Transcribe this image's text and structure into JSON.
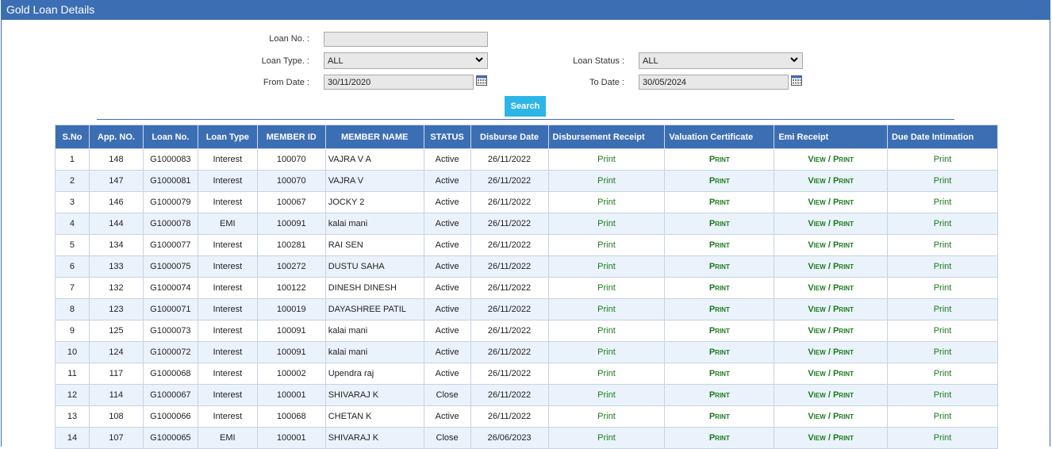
{
  "header": {
    "title": "Gold Loan Details"
  },
  "filters": {
    "loan_no_label": "Loan No. :",
    "loan_no_value": "",
    "loan_type_label": "Loan Type. :",
    "loan_type_value": "ALL",
    "loan_status_label": "Loan Status :",
    "loan_status_value": "ALL",
    "from_date_label": "From Date :",
    "from_date_value": "30/11/2020",
    "to_date_label": "To Date :",
    "to_date_value": "30/05/2024",
    "search_label": "Search"
  },
  "table": {
    "headers": [
      "S.No",
      "App. NO.",
      "Loan No.",
      "Loan Type",
      "MEMBER ID",
      "MEMBER NAME",
      "STATUS",
      "Disburse Date",
      "Disbursement Receipt",
      "Valuation Certificate",
      "Emi Receipt",
      "Due Date Intimation"
    ],
    "rows": [
      {
        "sno": "1",
        "app": "148",
        "loan": "G1000083",
        "type": "Interest",
        "member_id": "100070",
        "name": "VAJRA V A",
        "status": "Active",
        "date": "26/11/2022",
        "disb": "Print",
        "val": "Print",
        "emi": "View / Print",
        "due": "Print"
      },
      {
        "sno": "2",
        "app": "147",
        "loan": "G1000081",
        "type": "Interest",
        "member_id": "100070",
        "name": "VAJRA V",
        "status": "Active",
        "date": "26/11/2022",
        "disb": "Print",
        "val": "Print",
        "emi": "View / Print",
        "due": "Print"
      },
      {
        "sno": "3",
        "app": "146",
        "loan": "G1000079",
        "type": "Interest",
        "member_id": "100067",
        "name": "JOCKY 2",
        "status": "Active",
        "date": "26/11/2022",
        "disb": "Print",
        "val": "Print",
        "emi": "View / Print",
        "due": "Print"
      },
      {
        "sno": "4",
        "app": "144",
        "loan": "G1000078",
        "type": "EMI",
        "member_id": "100091",
        "name": "kalai mani",
        "status": "Active",
        "date": "26/11/2022",
        "disb": "Print",
        "val": "Print",
        "emi": "View / Print",
        "due": "Print"
      },
      {
        "sno": "5",
        "app": "134",
        "loan": "G1000077",
        "type": "Interest",
        "member_id": "100281",
        "name": "RAI SEN",
        "status": "Active",
        "date": "26/11/2022",
        "disb": "Print",
        "val": "Print",
        "emi": "View / Print",
        "due": "Print"
      },
      {
        "sno": "6",
        "app": "133",
        "loan": "G1000075",
        "type": "Interest",
        "member_id": "100272",
        "name": "DUSTU SAHA",
        "status": "Active",
        "date": "26/11/2022",
        "disb": "Print",
        "val": "Print",
        "emi": "View / Print",
        "due": "Print"
      },
      {
        "sno": "7",
        "app": "132",
        "loan": "G1000074",
        "type": "Interest",
        "member_id": "100122",
        "name": "DINESH DINESH",
        "status": "Active",
        "date": "26/11/2022",
        "disb": "Print",
        "val": "Print",
        "emi": "View / Print",
        "due": "Print"
      },
      {
        "sno": "8",
        "app": "123",
        "loan": "G1000071",
        "type": "Interest",
        "member_id": "100019",
        "name": "DAYASHREE PATIL",
        "status": "Active",
        "date": "26/11/2022",
        "disb": "Print",
        "val": "Print",
        "emi": "View / Print",
        "due": "Print"
      },
      {
        "sno": "9",
        "app": "125",
        "loan": "G1000073",
        "type": "Interest",
        "member_id": "100091",
        "name": "kalai mani",
        "status": "Active",
        "date": "26/11/2022",
        "disb": "Print",
        "val": "Print",
        "emi": "View / Print",
        "due": "Print"
      },
      {
        "sno": "10",
        "app": "124",
        "loan": "G1000072",
        "type": "Interest",
        "member_id": "100091",
        "name": "kalai mani",
        "status": "Active",
        "date": "26/11/2022",
        "disb": "Print",
        "val": "Print",
        "emi": "View / Print",
        "due": "Print"
      },
      {
        "sno": "11",
        "app": "117",
        "loan": "G1000068",
        "type": "Interest",
        "member_id": "100002",
        "name": "Upendra raj",
        "status": "Active",
        "date": "26/11/2022",
        "disb": "Print",
        "val": "Print",
        "emi": "View / Print",
        "due": "Print"
      },
      {
        "sno": "12",
        "app": "114",
        "loan": "G1000067",
        "type": "Interest",
        "member_id": "100001",
        "name": "SHIVARAJ K",
        "status": "Close",
        "date": "26/11/2022",
        "disb": "Print",
        "val": "Print",
        "emi": "View / Print",
        "due": "Print"
      },
      {
        "sno": "13",
        "app": "108",
        "loan": "G1000066",
        "type": "Interest",
        "member_id": "100068",
        "name": "CHETAN K",
        "status": "Active",
        "date": "26/11/2022",
        "disb": "Print",
        "val": "Print",
        "emi": "View / Print",
        "due": "Print"
      },
      {
        "sno": "14",
        "app": "107",
        "loan": "G1000065",
        "type": "EMI",
        "member_id": "100001",
        "name": "SHIVARAJ K",
        "status": "Close",
        "date": "26/06/2023",
        "disb": "Print",
        "val": "Print",
        "emi": "View / Print",
        "due": "Print"
      }
    ]
  },
  "colors": {
    "header_bg": "#3c6eb4",
    "search_bg": "#2cb6e8",
    "link_green": "#1d7a1d",
    "alt_row": "#eaf3fb"
  },
  "icons": [
    "calendar-icon",
    "chevron-down-icon"
  ]
}
